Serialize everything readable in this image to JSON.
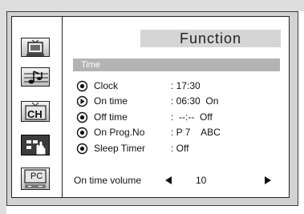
{
  "menu": {
    "title": "Function",
    "section": "Time"
  },
  "sidebar": {
    "items": [
      {
        "icon": "picture-icon"
      },
      {
        "icon": "sound-note-icon"
      },
      {
        "icon": "channel-icon",
        "label": "CH"
      },
      {
        "icon": "setup-hand-icon",
        "active": true
      },
      {
        "icon": "pc-icon",
        "label": "PC"
      }
    ]
  },
  "rows": [
    {
      "label": "Clock",
      "value": ": 17:30",
      "icon": "radio-dot-icon"
    },
    {
      "label": "On time",
      "value": ": 06:30  On",
      "icon": "play-arrow-icon"
    },
    {
      "label": "Off time",
      "value": ":  --:--  Off",
      "icon": "radio-dot-icon"
    },
    {
      "label": "On Prog.No",
      "value": ": P 7    ABC",
      "icon": "radio-dot-icon"
    },
    {
      "label": "Sleep Timer",
      "value": ": Off",
      "icon": "radio-dot-icon"
    }
  ],
  "volume": {
    "label": "On time volume",
    "value": "10"
  },
  "colors": {
    "panel_bg": "#ffffff",
    "title_tab_bg": "#d5d5d5",
    "section_bar_bg": "#b3b3b3",
    "active_icon_bg": "#3c3c3c"
  }
}
